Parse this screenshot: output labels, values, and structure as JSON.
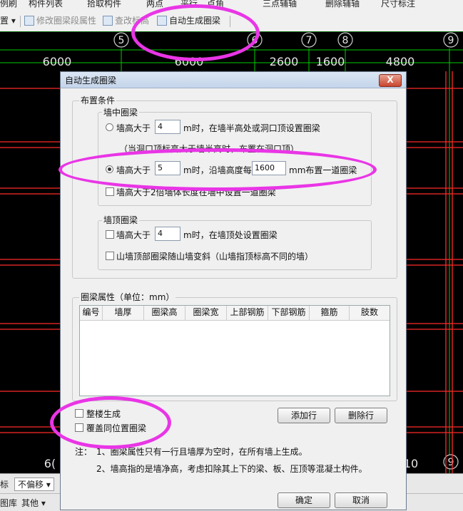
{
  "toolbar_top": {
    "items": [
      "例刷",
      "构件列表",
      "拾取构件",
      "两点",
      "平行",
      "点角",
      "三点辅轴",
      "删除辅轴",
      "尺寸标注"
    ]
  },
  "toolbar": {
    "set_label": "置",
    "modify_segment": "修改圈梁段属性",
    "check_elevation": "查改标高",
    "auto_generate": "自动生成圈梁"
  },
  "canvas": {
    "axis_numbers": [
      "5",
      "6",
      "7",
      "8",
      "9",
      "9"
    ],
    "dimensions": [
      "6000",
      "6000",
      "2600",
      "1600",
      "4800"
    ],
    "bottom_left_text": "6(",
    "bottom_right_text": "10"
  },
  "status": {
    "left_label": "标",
    "mode": "不偏移",
    "lib": "图库",
    "other": "其他"
  },
  "dialog": {
    "title": "自动生成圈梁",
    "close": "X",
    "placement_group": "布置条件",
    "wall_mid_group": "墙中圈梁",
    "opt1_prefix": "墙高大于",
    "opt1_value": "4",
    "opt1_suffix": "m时，在墙半高处或洞口顶设置圈梁",
    "opt1_note": "（当洞口顶标高大于墙半高时，布置在洞口顶）",
    "opt2_prefix": "墙高大于",
    "opt2_value": "5",
    "opt2_mid": "m时，沿墙高度每",
    "opt2_spacing": "1600",
    "opt2_suffix": "mm布置一道圈梁",
    "opt3": "墙高大于2倍墙体长度在墙中设置一道圈梁",
    "wall_top_group": "墙顶圈梁",
    "top1_prefix": "墙高大于",
    "top1_value": "4",
    "top1_suffix": "m时，在墙顶处设置圈梁",
    "top2": "山墙顶部圈梁随山墙变斜（山墙指顶标高不同的墙）",
    "attr_group": "圈梁属性（单位：mm）",
    "columns": [
      "编号",
      "墙厚",
      "圈梁高",
      "圈梁宽",
      "上部钢筋",
      "下部钢筋",
      "箍筋",
      "肢数"
    ],
    "whole_building": "整楼生成",
    "overwrite": "覆盖同位置圈梁",
    "add_row": "添加行",
    "delete_row": "删除行",
    "note_label": "注：",
    "note1": "1、圈梁属性只有一行且墙厚为空时，在所有墙上生成。",
    "note2": "2、墙高指的是墙净高，考虑扣除其上下的梁、板、压顶等混凝土构件。",
    "ok": "确定",
    "cancel": "取消"
  },
  "colors": {
    "annotation": "#e935e6",
    "canvas_bg": "#000000",
    "axis_line": "#00cc00",
    "wall_line": "#ff2a2a"
  }
}
